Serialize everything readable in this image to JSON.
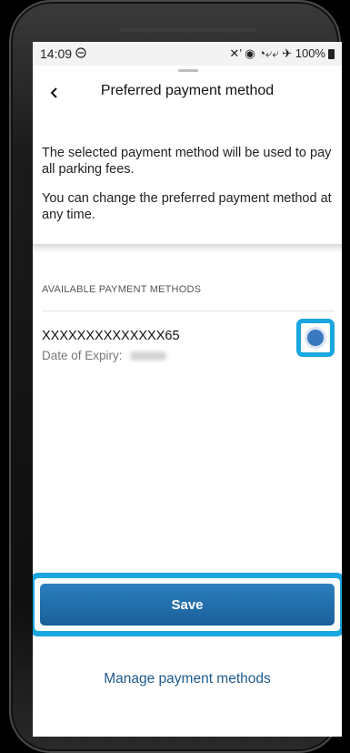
{
  "status_bar": {
    "time": "14:09",
    "time_icon": "minus-circle-icon",
    "indicators": "✕’ ◉ ◔⤶⤶ ✈ 100%",
    "battery_icon": "battery-icon"
  },
  "header": {
    "back_label": "‹",
    "title": "Preferred payment method"
  },
  "description": {
    "line1": "The selected payment method will be used to pay all parking fees.",
    "line2": "You can change the preferred payment method at any time."
  },
  "payment_methods": {
    "section_label": "AVAILABLE PAYMENT METHODS",
    "items": [
      {
        "number": "XXXXXXXXXXXXXX65",
        "expiry_label": "Date of Expiry:",
        "selected": true
      }
    ]
  },
  "actions": {
    "save_label": "Save",
    "manage_label": "Manage payment methods"
  },
  "colors": {
    "accent": "#1aa6df",
    "primary_button": "#1f6aa8",
    "link": "#1e5a8c"
  }
}
